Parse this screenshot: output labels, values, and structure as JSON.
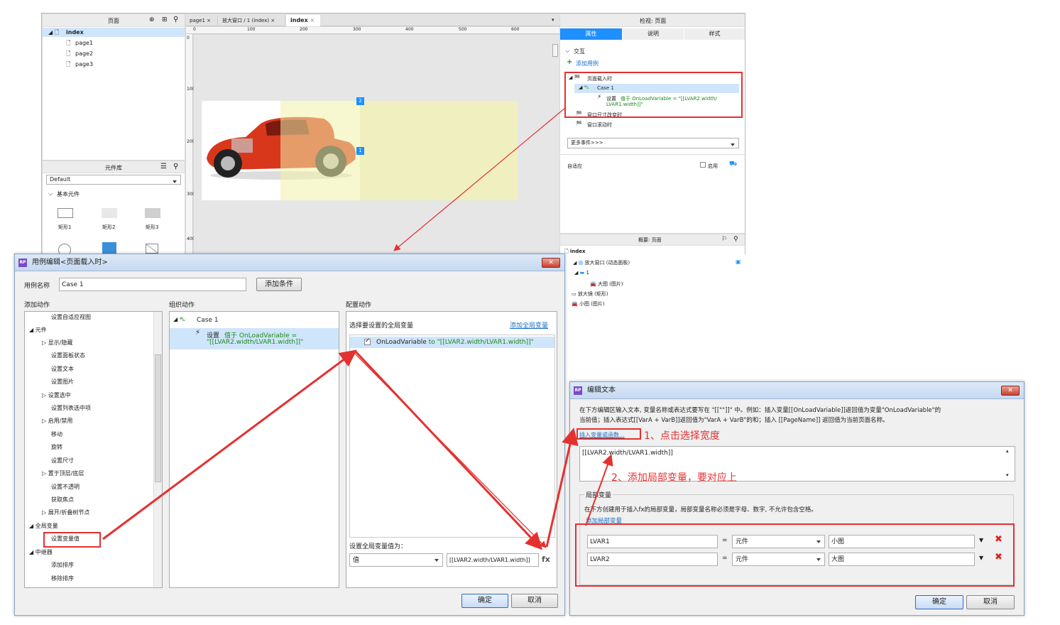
{
  "pages_panel": {
    "title": "页面",
    "root": "index",
    "items": [
      "page1",
      "page2",
      "page3"
    ]
  },
  "widgets_panel": {
    "title": "元件库",
    "library": "Default",
    "section": "基本元件",
    "widgets": [
      "矩形1",
      "矩形2",
      "矩形3"
    ]
  },
  "tabs": [
    {
      "label": "page1"
    },
    {
      "label": "放大窗口 / 1 (index)"
    },
    {
      "label": "index"
    }
  ],
  "ruler": {
    "ticks": [
      "0",
      "100",
      "200",
      "300",
      "400",
      "500",
      "600"
    ],
    "vticks": [
      "0",
      "100",
      "200",
      "300",
      "400"
    ]
  },
  "canvas": {
    "badge1": "2",
    "badge2": "1"
  },
  "inspector": {
    "title": "检视: 页面",
    "tabs": [
      "属性",
      "说明",
      "样式"
    ],
    "interaction": "交互",
    "add_case": "添加用例",
    "event1": "页面载入时",
    "case": "Case 1",
    "action_prefix": "设置",
    "action_value": "值于 OnLoadVariable = \"[[LVAR2.width/",
    "action_value2": "LVAR1.width]]\"",
    "event2": "窗口尺寸改变时",
    "event3": "窗口滚动时",
    "more_events": "更多事件>>>",
    "adaptive": "自适应",
    "enable": "启用"
  },
  "outline": {
    "title": "概要: 页面",
    "root": "index",
    "items": [
      "放大窗口 (动态面板)",
      "1",
      "大图 (图片)",
      "放大镜 (矩形)",
      "小图 (图片)"
    ]
  },
  "case_editor": {
    "title": "用例编辑<页面载入时>",
    "case_name_label": "用例名称",
    "case_name": "Case 1",
    "add_condition": "添加条件",
    "col_add": "添加动作",
    "col_org": "组织动作",
    "col_config": "配置动作",
    "actions": [
      "设置自适应视图",
      "元件",
      "显示/隐藏",
      "设置面板状态",
      "设置文本",
      "设置图片",
      "设置选中",
      "设置列表选中项",
      "启用/禁用",
      "移动",
      "旋转",
      "设置尺寸",
      "置于顶层/底层",
      "设置不透明",
      "获取焦点",
      "展开/折叠树节点",
      "全局变量",
      "设置变量值",
      "中继器",
      "添加排序",
      "移除排序"
    ],
    "org_case": "Case 1",
    "org_action": "设置",
    "org_value": "值于 OnLoadVariable =",
    "org_value2": "\"[[LVAR2.width/LVAR1.width]]\"",
    "select_global": "选择要设置的全局变量",
    "add_global": "添加全局变量",
    "var_row_name": "OnLoadVariable",
    "var_row_to": " to \"[[LVAR2.width/LVAR1.width]]\"",
    "set_global_label": "设置全局变量值为：",
    "value_type": "值",
    "value_expr": "[[LVAR2.width/LVAR1.width]]",
    "fx": "fx",
    "ok": "确定",
    "cancel": "取消"
  },
  "text_editor": {
    "title": "编辑文本",
    "desc1": "在下方编辑区输入文本, 变量名称或表达式要写在 \"[[\"\"]]\" 中。例如：插入变量[[OnLoadVariable]]返回值为变量\"OnLoadVariable\"的",
    "desc2": "当前值；插入表达式[[VarA + VarB]]返回值为\"VarA + VarB\"的和；插入 [[PageName]] 返回值为当前页面名称。",
    "insert_link": "插入变量或函数...",
    "expr": "[[LVAR2.width/LVAR1.width]]",
    "local_title": "局部变量",
    "local_desc": "在下方创建用于插入fx的局部变量，局部变量名称必须是字母、数字, 不允许包含空格。",
    "add_local": "添加局部变量",
    "rows": [
      {
        "name": "LVAR1",
        "eq": "=",
        "type": "元件",
        "target": "小图"
      },
      {
        "name": "LVAR2",
        "eq": "=",
        "type": "元件",
        "target": "大图"
      }
    ],
    "ok": "确定",
    "cancel": "取消"
  },
  "annotations": {
    "step1": "1、点击选择宽度",
    "step2": "2、添加局部变量，要对应上"
  },
  "colors": {
    "accent": "#1e90ff",
    "annotation": "#e53030"
  }
}
